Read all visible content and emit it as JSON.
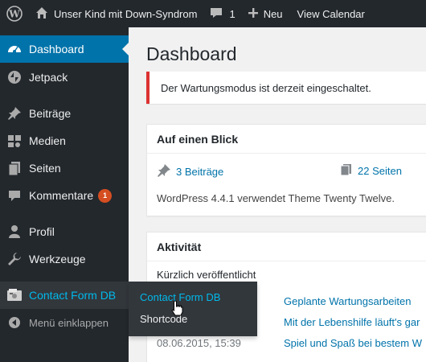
{
  "adminbar": {
    "site_name": "Unser Kind mit Down-Syndrom",
    "comments_count": "1",
    "new_label": "Neu",
    "calendar_label": "View Calendar"
  },
  "sidebar": {
    "items": [
      {
        "label": "Dashboard",
        "icon": "dashboard-icon"
      },
      {
        "label": "Jetpack",
        "icon": "jetpack-icon"
      },
      {
        "label": "Beiträge",
        "icon": "pin-icon"
      },
      {
        "label": "Medien",
        "icon": "media-icon"
      },
      {
        "label": "Seiten",
        "icon": "pages-icon"
      },
      {
        "label": "Kommentare",
        "icon": "comment-icon",
        "badge": "1"
      },
      {
        "label": "Profil",
        "icon": "user-icon"
      },
      {
        "label": "Werkzeuge",
        "icon": "wrench-icon"
      },
      {
        "label": "Contact Form DB",
        "icon": "contact-form-db-icon"
      }
    ],
    "collapse_label": "Menü einklappen",
    "flyout": [
      "Contact Form DB",
      "Shortcode"
    ]
  },
  "main": {
    "title": "Dashboard",
    "notice": "Der Wartungsmodus ist derzeit eingeschaltet.",
    "glance": {
      "title": "Auf einen Blick",
      "posts": "3 Beiträge",
      "pages": "22 Seiten",
      "version_text": "WordPress 4.4.1 verwendet Theme Twenty Twelve."
    },
    "activity": {
      "title": "Aktivität",
      "recent_title": "Kürzlich veröffentlicht",
      "rows": [
        {
          "date": "",
          "title": "Geplante Wartungsarbeiten"
        },
        {
          "date": "",
          "title": "Mit der Lebenshilfe läuft's gar"
        },
        {
          "date": "08.06.2015, 15:39",
          "title": "Spiel und Spaß bei bestem W"
        }
      ]
    }
  },
  "colors": {
    "adminbar_bg": "#23282d",
    "accent": "#0073aa",
    "highlight": "#00b9eb",
    "notice_border": "#dc3232",
    "badge": "#d54e21"
  }
}
